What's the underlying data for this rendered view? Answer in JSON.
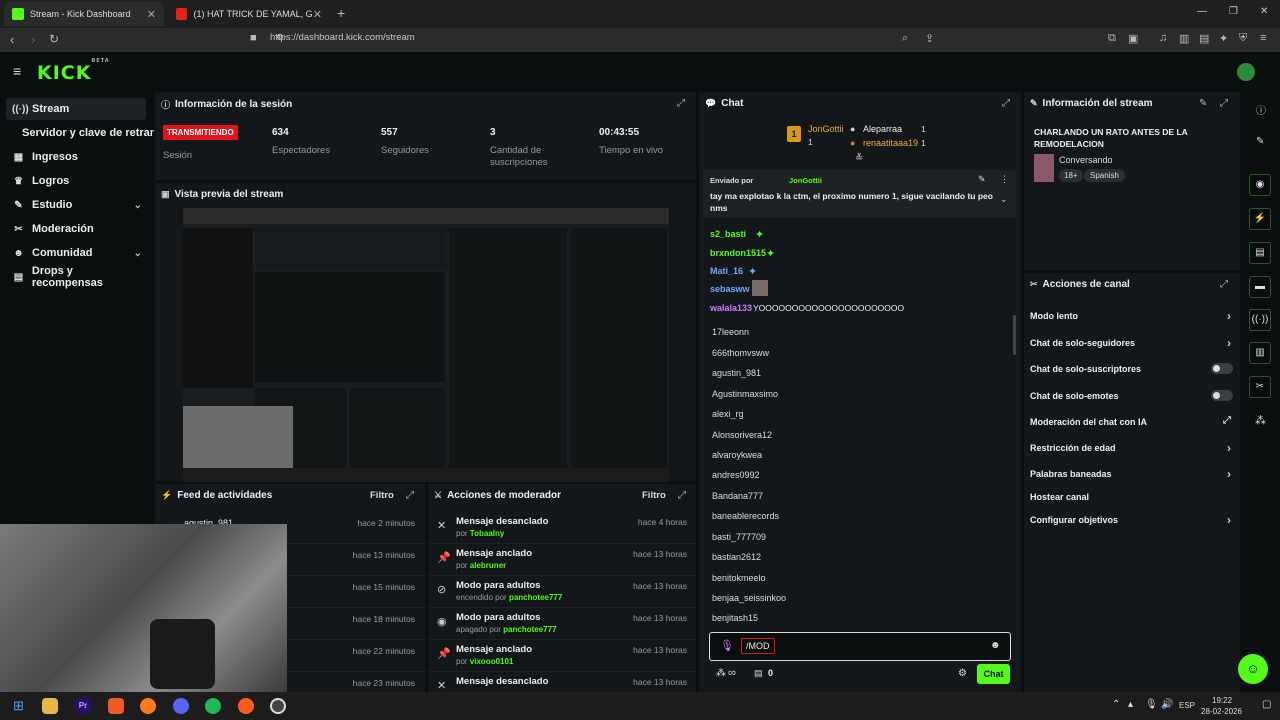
{
  "browser": {
    "tabs": [
      {
        "title": "Stream - Kick Dashboard",
        "active": true
      },
      {
        "title": "(1) HAT TRICK DE YAMAL, GOLEADA"
      }
    ],
    "url": "https://dashboard.kick.com/stream",
    "new_tab": "+",
    "window_min": "—",
    "window_max": "❐",
    "window_close": "✕"
  },
  "kick": {
    "logo": "KICK",
    "beta": "BETA"
  },
  "sidebar": {
    "items": [
      {
        "label": "Stream",
        "icon": "broadcast-icon"
      },
      {
        "label": "Servidor y clave de retransmisión"
      },
      {
        "label": "Ingresos",
        "icon": "chart-icon"
      },
      {
        "label": "Logros",
        "icon": "trophy-icon"
      },
      {
        "label": "Estudio",
        "icon": "studio-icon"
      },
      {
        "label": "Moderación",
        "icon": "wrench-icon"
      },
      {
        "label": "Comunidad",
        "icon": "users-icon"
      },
      {
        "label": "Drops y recompensas",
        "icon": "gift-icon"
      }
    ]
  },
  "session": {
    "title": "Información de la sesión",
    "live_badge": "TRANSMITIENDO",
    "session_label": "Sesión",
    "stats": [
      {
        "value": "634",
        "label": "Espectadores"
      },
      {
        "value": "557",
        "label": "Seguidores"
      },
      {
        "value": "3",
        "label": "Cantidad de suscripciones"
      },
      {
        "value": "00:43:55",
        "label": "Tiempo en vivo"
      }
    ]
  },
  "preview": {
    "title": "Vista previa del stream"
  },
  "activity": {
    "title": "Feed de actividades",
    "filter": "Filtro",
    "rows": [
      {
        "user": "agustin_981",
        "time": "hace 2 minutos"
      },
      {
        "user": "",
        "time": "hace 13 minutos"
      },
      {
        "user": "",
        "time": "hace 15 minutos"
      },
      {
        "user": "",
        "time": "hace 18 minutos"
      },
      {
        "user": "",
        "time": "hace 22 minutos"
      },
      {
        "user": "",
        "time": "hace 23 minutos"
      }
    ]
  },
  "mod_actions": {
    "title": "Acciones de moderador",
    "filter": "Filtro",
    "rows": [
      {
        "title": "Mensaje desanclado",
        "prefix": "por",
        "user": "Tobaalny",
        "time": "hace 4 horas"
      },
      {
        "title": "Mensaje anclado",
        "prefix": "por",
        "user": "alebruner",
        "time": "hace 13 horas"
      },
      {
        "title": "Modo para adultos",
        "prefix": "encendido por",
        "user": "panchotee777",
        "time": "hace 13 horas"
      },
      {
        "title": "Modo para adultos",
        "prefix": "apagado por",
        "user": "panchotee777",
        "time": "hace 13 horas"
      },
      {
        "title": "Mensaje anclado",
        "prefix": "por",
        "user": "vixooo0101",
        "time": "hace 13 horas"
      },
      {
        "title": "Mensaje desanclado",
        "prefix": "",
        "user": "",
        "time": "hace 13 horas"
      }
    ]
  },
  "chat": {
    "title": "Chat",
    "top_gifters": [
      {
        "rank": "1",
        "name": "JonGottii",
        "count": "1"
      },
      {
        "name": "Aleparraa",
        "count": "1"
      },
      {
        "name": "renaatitaaa19",
        "count": "1"
      }
    ],
    "pinned": {
      "label": "Enviado por",
      "user": "JonGottii",
      "text": "tay ma explotao k la ctm, el proximo numero 1, sigue vacilando tu peo nms"
    },
    "messages": [
      {
        "user": "s2_basti",
        "color": "#53fc18"
      },
      {
        "user": "brxndon1515",
        "color": "#53fc18"
      },
      {
        "user": "Mati_16",
        "color": "#6fa8ff"
      },
      {
        "user": "sebasww",
        "color": "#6fa8ff"
      },
      {
        "user": "walala133",
        "color": "#c77dff",
        "text": "YOOOOOOOOOOOOOOOOOOOOOO"
      }
    ],
    "user_list": [
      "17leeonn",
      "666thomvsww",
      "agustin_981",
      "Agustinmaxsimo",
      "alexi_rg",
      "Alonsorivera12",
      "alvaroykwea",
      "andres0992",
      "Bandana777",
      "baneablerecords",
      "basti_777709",
      "bastian2612",
      "benitokmeelo",
      "benjaa_seissinkoo",
      "benjitash15"
    ],
    "input_value": "/MOD",
    "points": "∞",
    "count": "0",
    "send": "Chat"
  },
  "stream_info": {
    "title": "Información del stream",
    "stream_title": "CHARLANDO UN RATO ANTES DE LA REMODELACION",
    "category": "Conversando",
    "tags": [
      "18+",
      "Spanish"
    ]
  },
  "channel_actions": {
    "title": "Acciones de canal",
    "rows": [
      {
        "label": "Modo lento",
        "type": "chevron"
      },
      {
        "label": "Chat de solo-seguidores",
        "type": "chevron"
      },
      {
        "label": "Chat de solo-suscriptores",
        "type": "toggle"
      },
      {
        "label": "Chat de solo-emotes",
        "type": "toggle"
      },
      {
        "label": "Moderación del chat con IA",
        "type": "external"
      },
      {
        "label": "Restricción de edad",
        "type": "chevron"
      },
      {
        "label": "Palabras baneadas",
        "type": "chevron"
      },
      {
        "label": "Hostear canal",
        "type": "none"
      },
      {
        "label": "Configurar objetivos",
        "type": "chevron"
      }
    ]
  },
  "taskbar": {
    "lang": "ESP",
    "time": "19:22",
    "date": "28-02-2026"
  },
  "colors": {
    "accent": "#53fc18",
    "live": "#e0151c",
    "panel": "#141719",
    "bg": "#0b0e0f"
  }
}
